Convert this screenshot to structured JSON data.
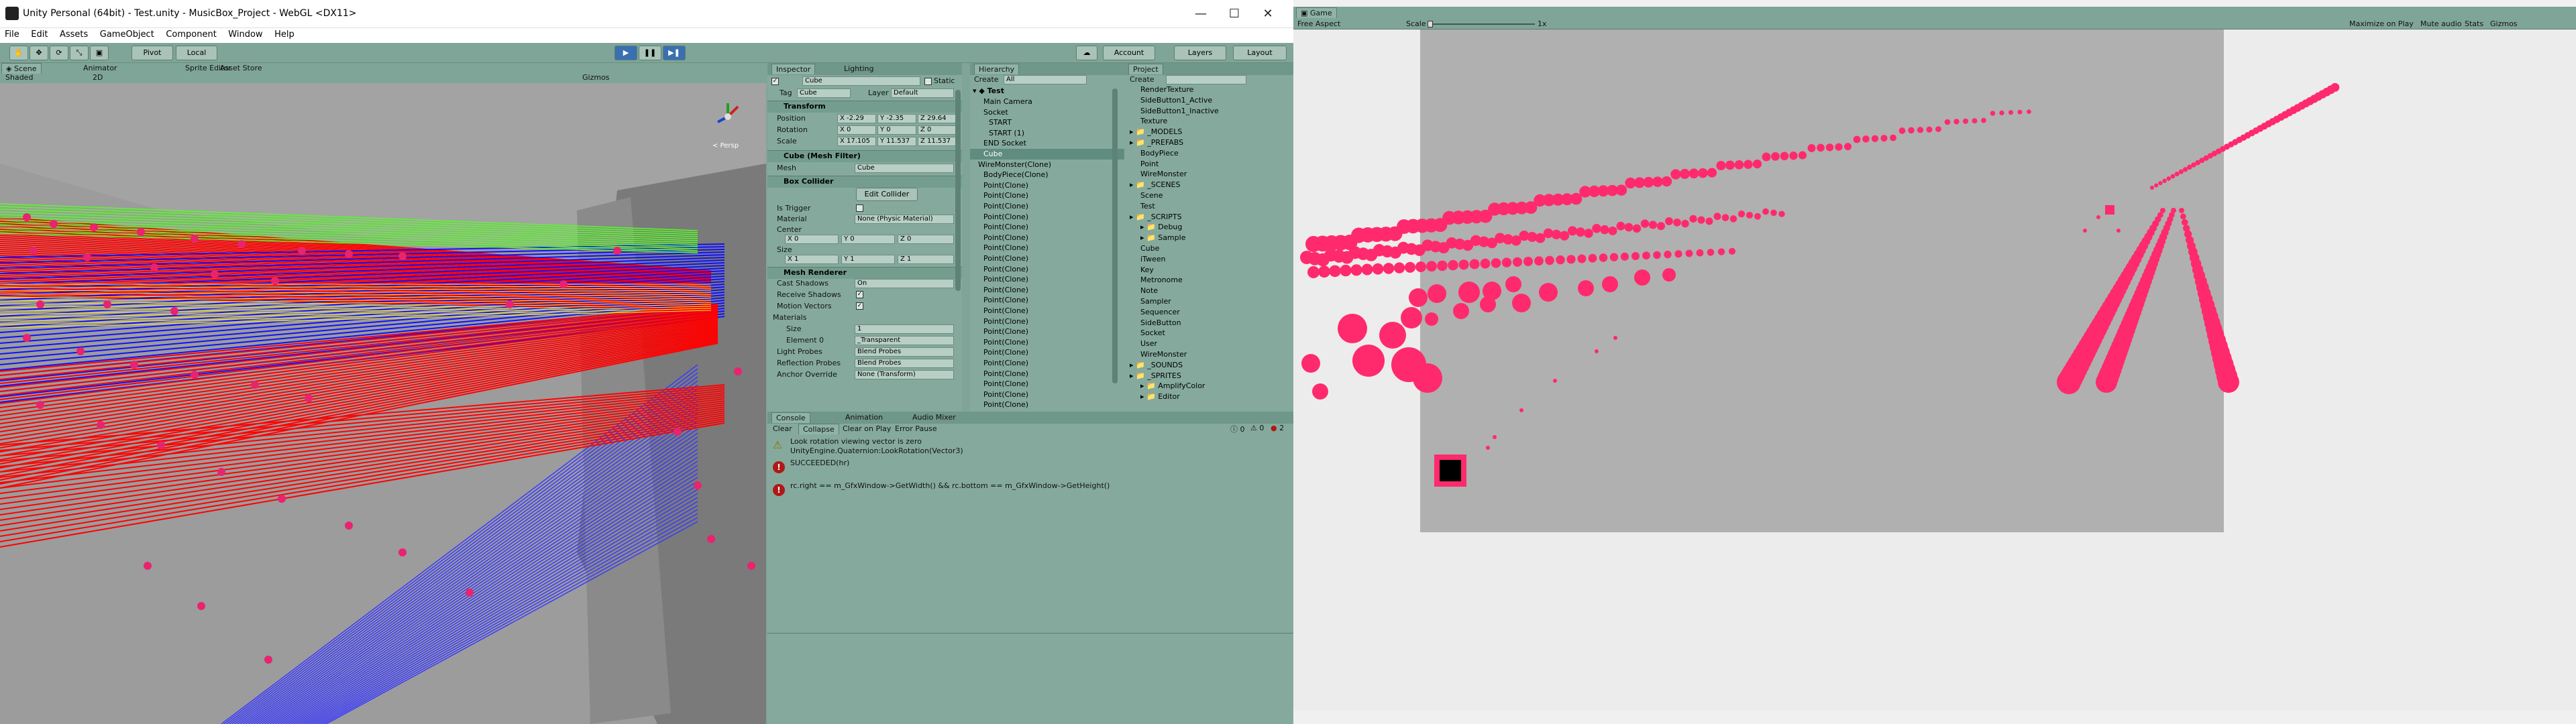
{
  "window": {
    "title": "Unity Personal (64bit) - Test.unity - MusicBox_Project - WebGL <DX11>",
    "minimize_glyph": "—",
    "maximize_glyph": "☐",
    "close_glyph": "✕"
  },
  "menu": [
    "File",
    "Edit",
    "Assets",
    "GameObject",
    "Component",
    "Window",
    "Help"
  ],
  "toolbar": {
    "pivot": "Pivot",
    "local": "Local",
    "account": "Account",
    "layers": "Layers",
    "layout": "Layout"
  },
  "scene": {
    "tabs": [
      "Scene",
      "Animator",
      "Sprite Editor",
      "Asset Store"
    ],
    "shading": "Shaded",
    "mode_2d": "2D",
    "gizmos": "Gizmos",
    "persp_label": "< Persp"
  },
  "inspector": {
    "tabs": [
      "Inspector",
      "Lighting"
    ],
    "object_name": "Cube",
    "static_label": "Static",
    "tag_label": "Tag",
    "tag_value": "Cube",
    "layer_label": "Layer",
    "layer_value": "Default",
    "transform": {
      "title": "Transform",
      "position_label": "Position",
      "rotation_label": "Rotation",
      "scale_label": "Scale",
      "position": [
        "X -2.29",
        "Y -2.35",
        "Z 29.64"
      ],
      "rotation": [
        "X 0",
        "Y 0",
        "Z 0"
      ],
      "scale": [
        "X 17.105",
        "Y 11.537",
        "Z 11.537"
      ]
    },
    "mesh_filter": {
      "title": "Cube (Mesh Filter)",
      "mesh_label": "Mesh",
      "mesh_value": "Cube"
    },
    "box_collider": {
      "title": "Box Collider",
      "edit_label": "Edit Collider",
      "is_trigger": "Is Trigger",
      "material_label": "Material",
      "material_value": "None (Physic Material)",
      "center_label": "Center",
      "center": [
        "X 0",
        "Y 0",
        "Z 0"
      ],
      "size_label": "Size",
      "size": [
        "X 1",
        "Y 1",
        "Z 1"
      ]
    },
    "mesh_renderer": {
      "title": "Mesh Renderer",
      "cast_shadows": "Cast Shadows",
      "cast_shadows_value": "On",
      "receive_shadows": "Receive Shadows",
      "motion_vectors": "Motion Vectors",
      "materials": "Materials",
      "size_label": "Size",
      "size_value": "1",
      "element_label": "Element 0",
      "element_value": "_Transparent",
      "light_probes": "Light Probes",
      "light_probes_value": "Blend Probes",
      "reflection_probes": "Reflection Probes",
      "reflection_probes_value": "Blend Probes",
      "anchor_override": "Anchor Override",
      "anchor_override_value": "None (Transform)"
    }
  },
  "hierarchy": {
    "tab": "Hierarchy",
    "create": "Create",
    "search_placeholder": "All",
    "scene_name": "Test",
    "items": [
      "Main Camera",
      "Socket",
      "START",
      "START (1)",
      "END Socket",
      "Cube",
      "WireMonster(Clone)",
      "BodyPiece(Clone)",
      "Point(Clone)",
      "Point(Clone)",
      "Point(Clone)",
      "Point(Clone)",
      "Point(Clone)",
      "Point(Clone)",
      "Point(Clone)",
      "Point(Clone)",
      "Point(Clone)",
      "Point(Clone)",
      "Point(Clone)",
      "Point(Clone)",
      "Point(Clone)",
      "Point(Clone)",
      "Point(Clone)",
      "Point(Clone)",
      "Point(Clone)",
      "Point(Clone)",
      "Point(Clone)",
      "Point(Clone)",
      "Point(Clone)",
      "Point(Clone)"
    ]
  },
  "project": {
    "tab": "Project",
    "create": "Create",
    "items": [
      "RenderTexture",
      "SideButton1_Active",
      "SideButton1_Inactive",
      "Texture",
      "_MODELS",
      "_PREFABS",
      "BodyPiece",
      "Point",
      "WireMonster",
      "_SCENES",
      "Scene",
      "Test",
      "_SCRIPTS",
      "Debug",
      "Sample",
      "Cube",
      "iTween",
      "Key",
      "Metronome",
      "Note",
      "Sampler",
      "Sequencer",
      "SideButton",
      "Socket",
      "User",
      "WireMonster",
      "_SOUNDS",
      "_SPRITES",
      "AmplifyColor",
      "Editor"
    ]
  },
  "console": {
    "tabs": [
      "Console",
      "Animation",
      "Audio Mixer"
    ],
    "buttons": [
      "Clear",
      "Collapse",
      "Clear on Play",
      "Error Pause"
    ],
    "counts": [
      "0",
      "0",
      "2"
    ],
    "messages": [
      {
        "line1": "Look rotation viewing vector is zero",
        "line2": "UnityEngine.Quaternion:LookRotation(Vector3)"
      },
      {
        "line1": "SUCCEEDED(hr)",
        "line2": ""
      },
      {
        "line1": "rc.right == m_GfxWindow->GetWidth() && rc.bottom == m_GfxWindow->GetHeight()",
        "line2": ""
      }
    ]
  },
  "game": {
    "tab": "Game",
    "aspect": "Free Aspect",
    "scale_label": "Scale",
    "scale_value": "1x",
    "options": [
      "Maximize on Play",
      "Mute audio",
      "Stats",
      "Gizmos"
    ]
  },
  "colors": {
    "panel": "#85aa9d",
    "dot": "#ff2a6d",
    "error": "#b01818"
  }
}
